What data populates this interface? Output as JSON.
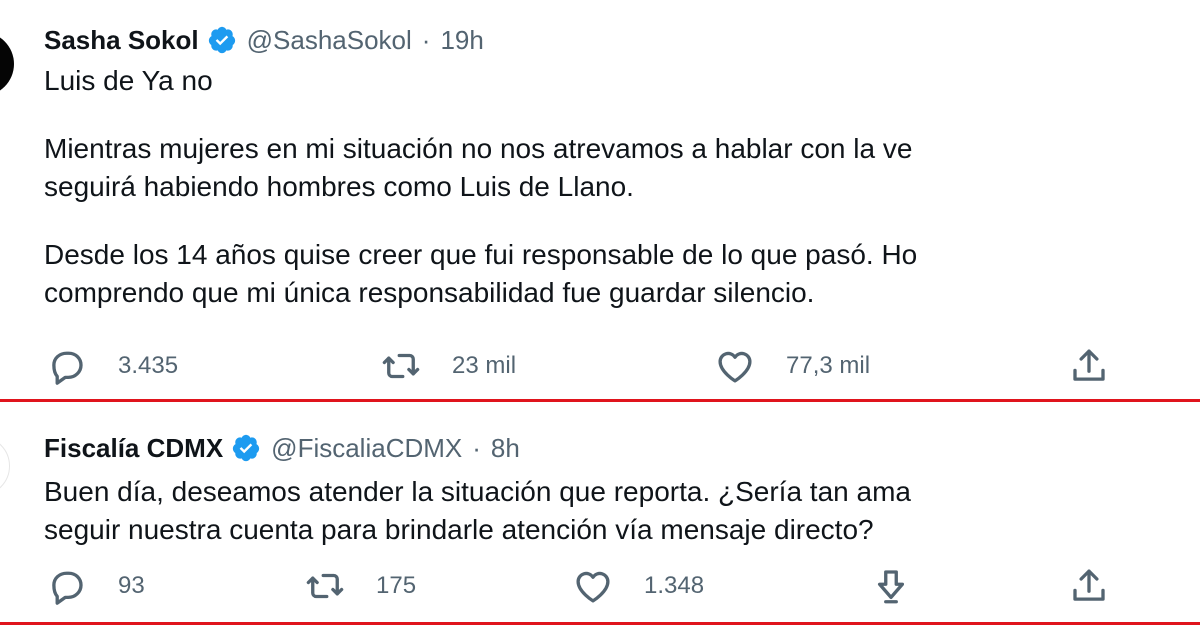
{
  "tweets": [
    {
      "display_name": "Sasha Sokol",
      "handle": "@SashaSokol",
      "separator": "·",
      "time": "19h",
      "lines": [
        "Luis de Ya no",
        "",
        "Mientras mujeres en mi situación no nos atrevamos a hablar con la ve",
        "seguirá habiendo hombres como Luis de Llano.",
        "",
        "Desde los 14 años quise creer que fui responsable de lo que pasó. Ho",
        "comprendo que mi única responsabilidad fue guardar silencio."
      ],
      "replies": "3.435",
      "retweets": "23 mil",
      "likes": "77,3 mil"
    },
    {
      "display_name": "Fiscalía CDMX",
      "handle": "@FiscaliaCDMX",
      "separator": "·",
      "time": "8h",
      "lines": [
        "Buen día, deseamos atender la situación que reporta. ¿Sería tan ama",
        "seguir nuestra cuenta para brindarle atención vía mensaje directo?"
      ],
      "replies": "93",
      "retweets": "175",
      "likes": "1.348"
    }
  ],
  "colors": {
    "verified_badge": "#1d9bf0",
    "secondary_text": "#536471",
    "divider": "#e0141d"
  },
  "icons": [
    "reply-icon",
    "retweet-icon",
    "like-icon",
    "bookmark-down-icon",
    "share-icon",
    "verified-badge-icon"
  ]
}
